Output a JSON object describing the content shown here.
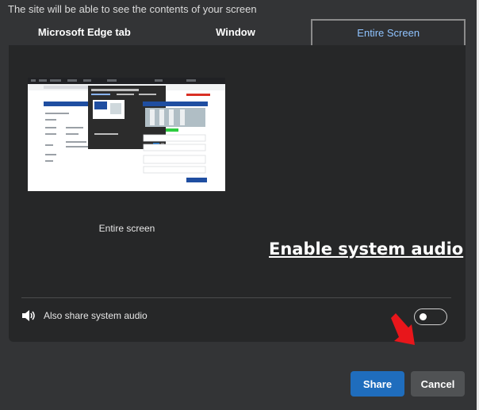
{
  "dialog": {
    "intro_text": "The site will be able to see the contents of your screen",
    "tabs": [
      {
        "label": "Microsoft Edge tab",
        "selected": false
      },
      {
        "label": "Window",
        "selected": false
      },
      {
        "label": "Entire Screen",
        "selected": true
      }
    ],
    "preview": {
      "label": "Entire screen",
      "thumbnail_icon": "screen-preview-thumbnail"
    },
    "audio": {
      "label": "Also share system audio",
      "icon": "speaker-icon",
      "enabled": false
    },
    "annotation": {
      "text": "Enable system audio",
      "arrow_icon": "red-arrow-icon",
      "arrow_color": "#e8161b"
    },
    "buttons": {
      "share_label": "Share",
      "cancel_label": "Cancel"
    },
    "colors": {
      "accent": "#1f6dbd",
      "active_tab_text": "#8fc3ff",
      "background": "#333436",
      "panel": "#262728"
    }
  }
}
